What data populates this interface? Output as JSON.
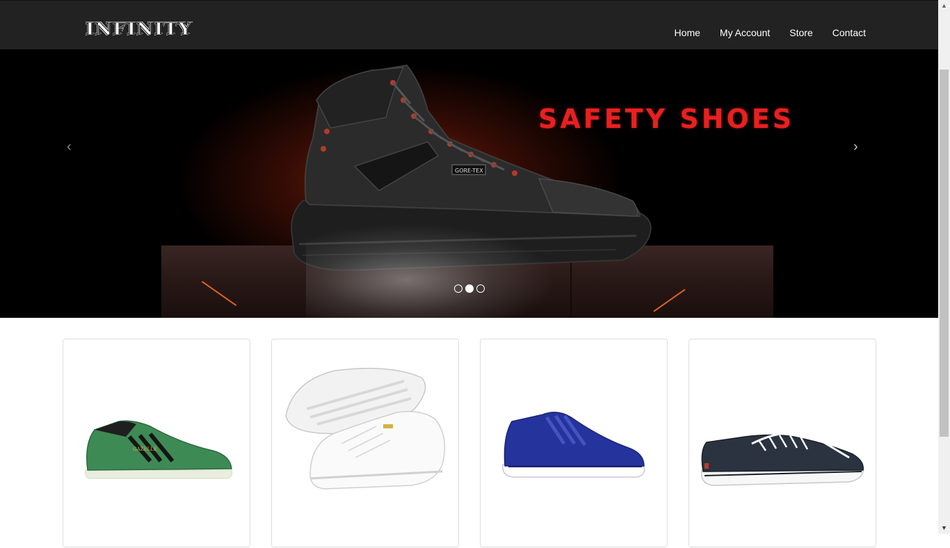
{
  "header": {
    "logo_text": "INFINITY",
    "nav": [
      "Home",
      "My Account",
      "Store",
      "Contact"
    ]
  },
  "carousel": {
    "slide_title": "SAFETY SHOES",
    "prev_icon": "‹",
    "next_icon": "›",
    "indicators": 3,
    "active_indicator": 2
  },
  "products": [
    {
      "name": "green-suede-sneaker-icon"
    },
    {
      "name": "white-leather-sneaker-icon"
    },
    {
      "name": "blue-knit-sneaker-icon"
    },
    {
      "name": "navy-canvas-sneaker-icon"
    }
  ],
  "scrollbar": {
    "up_icon": "▲",
    "down_icon": "▼"
  },
  "colors": {
    "navbar": "#222222",
    "slide_title": "#e8201f",
    "card_border": "#dddddd"
  }
}
